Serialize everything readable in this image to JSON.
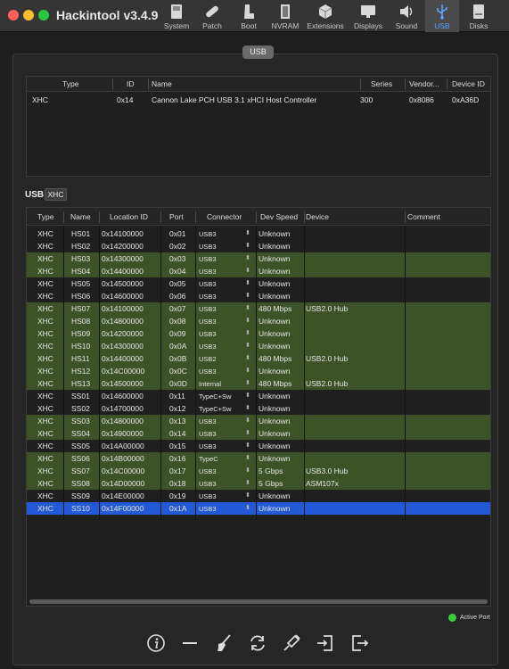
{
  "window": {
    "title": "Hackintool v3.4.9"
  },
  "toolbar": [
    {
      "label": "System"
    },
    {
      "label": "Patch"
    },
    {
      "label": "Boot"
    },
    {
      "label": "NVRAM"
    },
    {
      "label": "Extensions"
    },
    {
      "label": "Displays"
    },
    {
      "label": "Sound"
    },
    {
      "label": "USB",
      "active": true
    },
    {
      "label": "Disks"
    }
  ],
  "section_pill": "USB",
  "controllers": {
    "headers": [
      "Type",
      "ID",
      "Name",
      "Series",
      "Vendor...",
      "Device ID"
    ],
    "rows": [
      {
        "type": "XHC",
        "id": "0x14",
        "name": "Cannon Lake PCH USB 3.1 xHCI Host Controller",
        "series": "300",
        "vendor": "0x8086",
        "device": "0xA36D"
      }
    ]
  },
  "usb_label": "USB",
  "usb_tag": "XHC",
  "ports": {
    "headers": [
      "Type",
      "Name",
      "Location ID",
      "Port",
      "Connector",
      "Dev Speed",
      "Device",
      "Comment"
    ],
    "rows": [
      {
        "type": "XHC",
        "name": "HS01",
        "loc": "0x14100000",
        "port": "0x01",
        "conn": "USB3",
        "speed": "Unknown",
        "device": "",
        "state": "d"
      },
      {
        "type": "XHC",
        "name": "HS02",
        "loc": "0x14200000",
        "port": "0x02",
        "conn": "USB3",
        "speed": "Unknown",
        "device": "",
        "state": "d"
      },
      {
        "type": "XHC",
        "name": "HS03",
        "loc": "0x14300000",
        "port": "0x03",
        "conn": "USB3",
        "speed": "Unknown",
        "device": "",
        "state": "g"
      },
      {
        "type": "XHC",
        "name": "HS04",
        "loc": "0x14400000",
        "port": "0x04",
        "conn": "USB3",
        "speed": "Unknown",
        "device": "",
        "state": "g"
      },
      {
        "type": "XHC",
        "name": "HS05",
        "loc": "0x14500000",
        "port": "0x05",
        "conn": "USB3",
        "speed": "Unknown",
        "device": "",
        "state": "d"
      },
      {
        "type": "XHC",
        "name": "HS06",
        "loc": "0x14600000",
        "port": "0x06",
        "conn": "USB3",
        "speed": "Unknown",
        "device": "",
        "state": "d"
      },
      {
        "type": "XHC",
        "name": "HS07",
        "loc": "0x14100000",
        "port": "0x07",
        "conn": "USB3",
        "speed": "480 Mbps",
        "device": "USB2.0 Hub",
        "state": "g"
      },
      {
        "type": "XHC",
        "name": "HS08",
        "loc": "0x14800000",
        "port": "0x08",
        "conn": "USB3",
        "speed": "Unknown",
        "device": "",
        "state": "g"
      },
      {
        "type": "XHC",
        "name": "HS09",
        "loc": "0x14200000",
        "port": "0x09",
        "conn": "USB3",
        "speed": "Unknown",
        "device": "",
        "state": "g"
      },
      {
        "type": "XHC",
        "name": "HS10",
        "loc": "0x14300000",
        "port": "0x0A",
        "conn": "USB3",
        "speed": "Unknown",
        "device": "",
        "state": "g"
      },
      {
        "type": "XHC",
        "name": "HS11",
        "loc": "0x14400000",
        "port": "0x0B",
        "conn": "USB2",
        "speed": "480 Mbps",
        "device": "USB2.0 Hub",
        "state": "g"
      },
      {
        "type": "XHC",
        "name": "HS12",
        "loc": "0x14C00000",
        "port": "0x0C",
        "conn": "USB3",
        "speed": "Unknown",
        "device": "",
        "state": "g"
      },
      {
        "type": "XHC",
        "name": "HS13",
        "loc": "0x14500000",
        "port": "0x0D",
        "conn": "Internal",
        "speed": "480 Mbps",
        "device": "USB2.0 Hub",
        "state": "g"
      },
      {
        "type": "XHC",
        "name": "SS01",
        "loc": "0x14600000",
        "port": "0x11",
        "conn": "TypeC+Sw",
        "speed": "Unknown",
        "device": "",
        "state": "d"
      },
      {
        "type": "XHC",
        "name": "SS02",
        "loc": "0x14700000",
        "port": "0x12",
        "conn": "TypeC+Sw",
        "speed": "Unknown",
        "device": "",
        "state": "d"
      },
      {
        "type": "XHC",
        "name": "SS03",
        "loc": "0x14800000",
        "port": "0x13",
        "conn": "USB3",
        "speed": "Unknown",
        "device": "",
        "state": "g"
      },
      {
        "type": "XHC",
        "name": "SS04",
        "loc": "0x14900000",
        "port": "0x14",
        "conn": "USB3",
        "speed": "Unknown",
        "device": "",
        "state": "g"
      },
      {
        "type": "XHC",
        "name": "SS05",
        "loc": "0x14A00000",
        "port": "0x15",
        "conn": "USB3",
        "speed": "Unknown",
        "device": "",
        "state": "d"
      },
      {
        "type": "XHC",
        "name": "SS06",
        "loc": "0x14B00000",
        "port": "0x16",
        "conn": "TypeC",
        "speed": "Unknown",
        "device": "",
        "state": "g"
      },
      {
        "type": "XHC",
        "name": "SS07",
        "loc": "0x14C00000",
        "port": "0x17",
        "conn": "USB3",
        "speed": "5 Gbps",
        "device": "USB3.0 Hub",
        "state": "g"
      },
      {
        "type": "XHC",
        "name": "SS08",
        "loc": "0x14D00000",
        "port": "0x18",
        "conn": "USB3",
        "speed": "5 Gbps",
        "device": "ASM107x",
        "state": "g"
      },
      {
        "type": "XHC",
        "name": "SS09",
        "loc": "0x14E00000",
        "port": "0x19",
        "conn": "USB3",
        "speed": "Unknown",
        "device": "",
        "state": "d"
      },
      {
        "type": "XHC",
        "name": "SS10",
        "loc": "0x14F00000",
        "port": "0x1A",
        "conn": "USB3",
        "speed": "Unknown",
        "device": "",
        "state": "sel"
      }
    ]
  },
  "legend": {
    "active_port": "Active Port"
  },
  "colors": {
    "active_row": "#3d5227",
    "selected_row": "#2159d6",
    "active_dot": "#3dcc3d"
  }
}
